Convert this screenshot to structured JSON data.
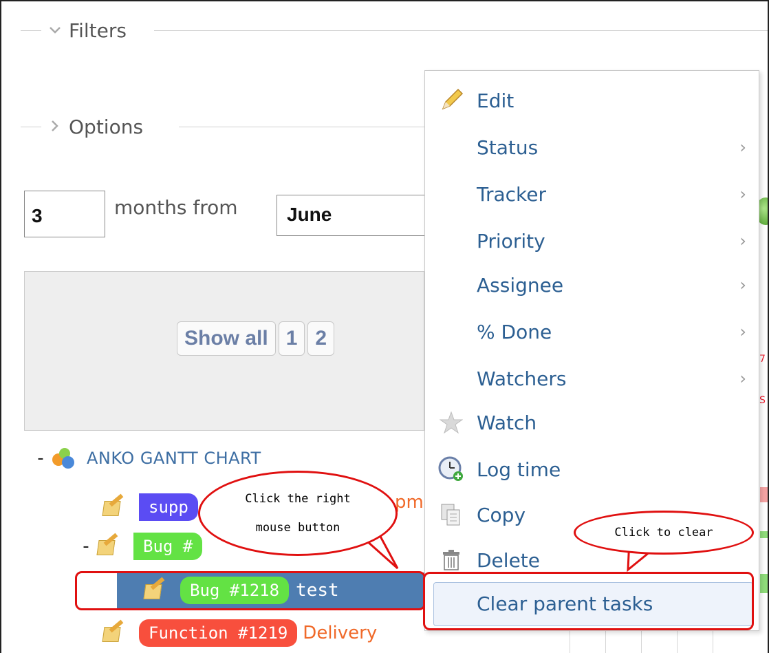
{
  "filters": {
    "label": "Filters"
  },
  "options": {
    "label": "Options"
  },
  "range": {
    "months_value": "3",
    "months_label": "months from",
    "from_month": "June"
  },
  "pagination": {
    "show_all": "Show all",
    "pages": [
      "1",
      "2"
    ]
  },
  "gantt": {
    "project_dash": "-",
    "project_name": "ANKO GANTT CHART",
    "rows": [
      {
        "pill": "supp",
        "subject": "pm",
        "color": "#5b4cf3"
      },
      {
        "dash": "-",
        "pill": "Bug #",
        "color": "#63e244"
      },
      {
        "pill": "Bug #1218",
        "subject": "test",
        "color": "#63e244"
      },
      {
        "pill": "Function #1219",
        "subject": "Delivery",
        "color": "#f84f3d"
      }
    ]
  },
  "context_menu": {
    "items": [
      {
        "label": "Edit",
        "icon": "pencil-icon",
        "submenu": false
      },
      {
        "label": "Status",
        "icon": "",
        "submenu": true
      },
      {
        "label": "Tracker",
        "icon": "",
        "submenu": true
      },
      {
        "label": "Priority",
        "icon": "",
        "submenu": true
      },
      {
        "label": "Assignee",
        "icon": "",
        "submenu": true
      },
      {
        "label": "% Done",
        "icon": "",
        "submenu": true
      },
      {
        "label": "Watchers",
        "icon": "",
        "submenu": true
      },
      {
        "label": "Watch",
        "icon": "star-icon",
        "submenu": false
      },
      {
        "label": "Log time",
        "icon": "clock-icon",
        "submenu": false
      },
      {
        "label": "Copy",
        "icon": "copy-icon",
        "submenu": false
      },
      {
        "label": "Delete",
        "icon": "trash-icon",
        "submenu": false
      }
    ],
    "highlighted": "Clear parent tasks"
  },
  "annotations": {
    "right_click_line1": "Click the right",
    "right_click_line2": "mouse button",
    "clear_note": "Click to clear"
  },
  "colors": {
    "accent_red": "#e01010",
    "link_blue": "#2c5f92",
    "selected_row": "#4e7db1"
  }
}
